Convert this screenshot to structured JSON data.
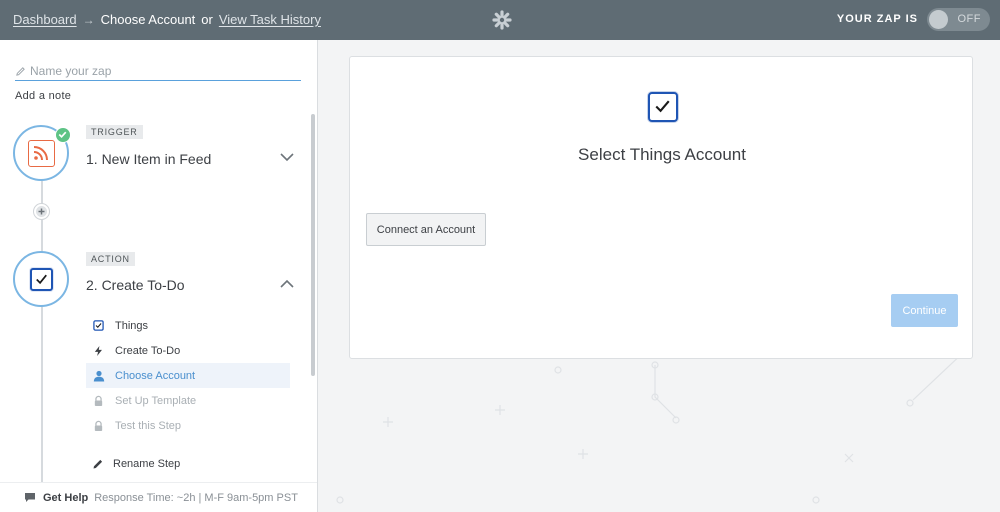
{
  "header": {
    "breadcrumb_dashboard": "Dashboard",
    "breadcrumb_arrow": "→",
    "breadcrumb_current": "Choose Account",
    "breadcrumb_or": "or",
    "breadcrumb_history": "View Task History",
    "zap_state_label": "YOUR ZAP IS",
    "toggle_label": "OFF"
  },
  "sidebar": {
    "name_placeholder": "Name your zap",
    "add_note": "Add a note",
    "steps": [
      {
        "tag": "TRIGGER",
        "title": "1. New Item in Feed",
        "status": "complete",
        "expanded": false
      },
      {
        "tag": "ACTION",
        "title": "2. Create To-Do",
        "expanded": true
      }
    ],
    "substeps": [
      {
        "label": "Things",
        "icon": "things-icon",
        "state": "done"
      },
      {
        "label": "Create To-Do",
        "icon": "bolt-icon",
        "state": "done"
      },
      {
        "label": "Choose Account",
        "icon": "user-icon",
        "state": "active"
      },
      {
        "label": "Set Up Template",
        "icon": "lock-icon",
        "state": "disabled"
      },
      {
        "label": "Test this Step",
        "icon": "lock-icon",
        "state": "disabled"
      }
    ],
    "rename": "Rename Step",
    "footer": {
      "get_help": "Get Help",
      "response": "Response Time: ~2h | M-F 9am-5pm PST"
    }
  },
  "main": {
    "card_title": "Select Things Account",
    "connect_button": "Connect an Account",
    "continue_button": "Continue"
  },
  "colors": {
    "header_bg": "#5f6c74",
    "accent_blue": "#4a8fce",
    "things_blue": "#1f55b4",
    "rss_orange": "#e86a44",
    "success_green": "#5dc385",
    "continue_disabled": "#a6cdf2"
  }
}
